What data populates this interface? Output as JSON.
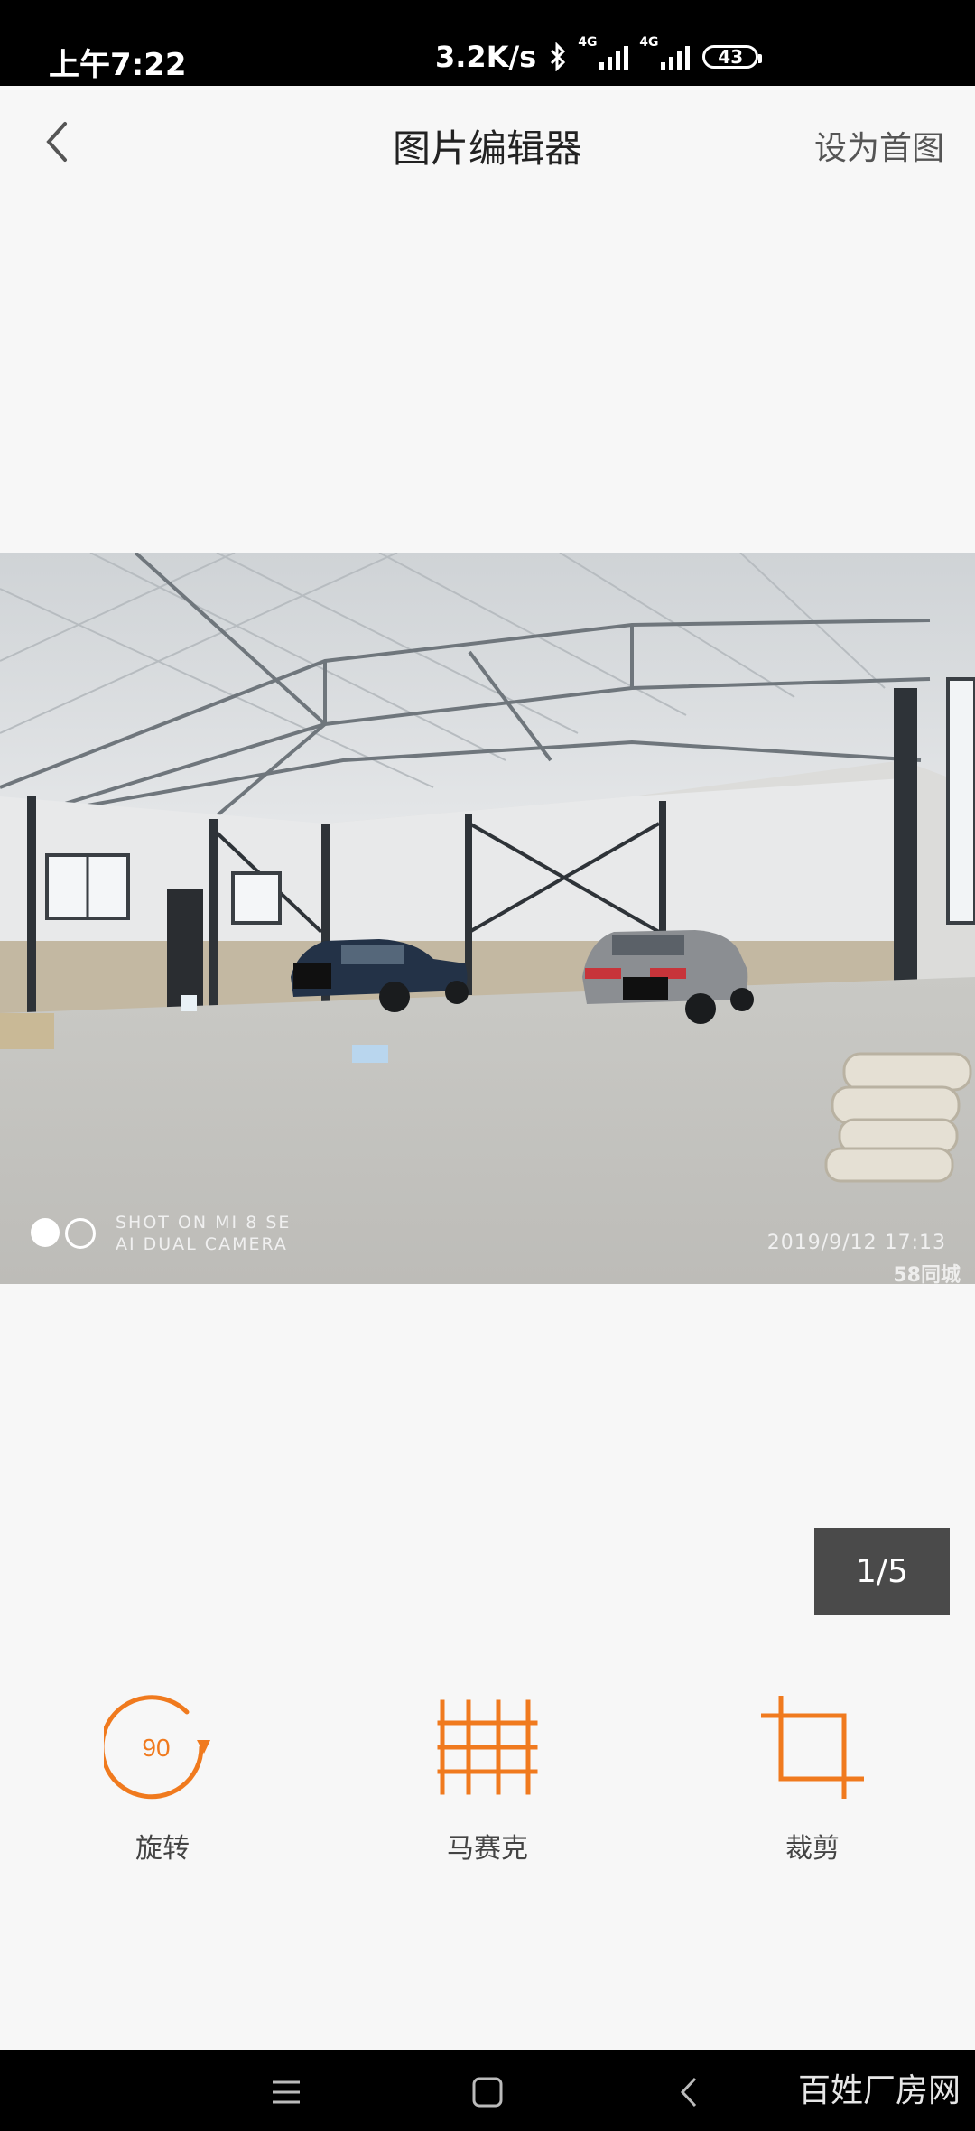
{
  "status_bar": {
    "time": "上午7:22",
    "net_speed": "3.2K/s",
    "network_1": "4G",
    "network_2": "4G",
    "battery": "43"
  },
  "header": {
    "title": "图片编辑器",
    "set_cover": "设为首图",
    "back_icon": "chevron-left-icon"
  },
  "photo": {
    "watermark_line1": "SHOT ON MI 8 SE",
    "watermark_line2": "AI DUAL CAMERA",
    "timestamp": "2019/9/12   17:13",
    "logo": "58同城"
  },
  "pager": {
    "text": "1/5"
  },
  "tools": [
    {
      "label": "旋转",
      "icon": "rotate-icon",
      "badge": "90"
    },
    {
      "label": "马赛克",
      "icon": "mosaic-icon"
    },
    {
      "label": "裁剪",
      "icon": "crop-icon"
    }
  ],
  "nav_bar": {
    "menu_icon": "menu-icon",
    "home_icon": "home-icon",
    "back_icon": "back-icon"
  },
  "site_watermark": "百姓厂房网",
  "colors": {
    "accent": "#f07a1e",
    "pager_bg": "#4a4a4a",
    "background": "#f7f7f7"
  }
}
